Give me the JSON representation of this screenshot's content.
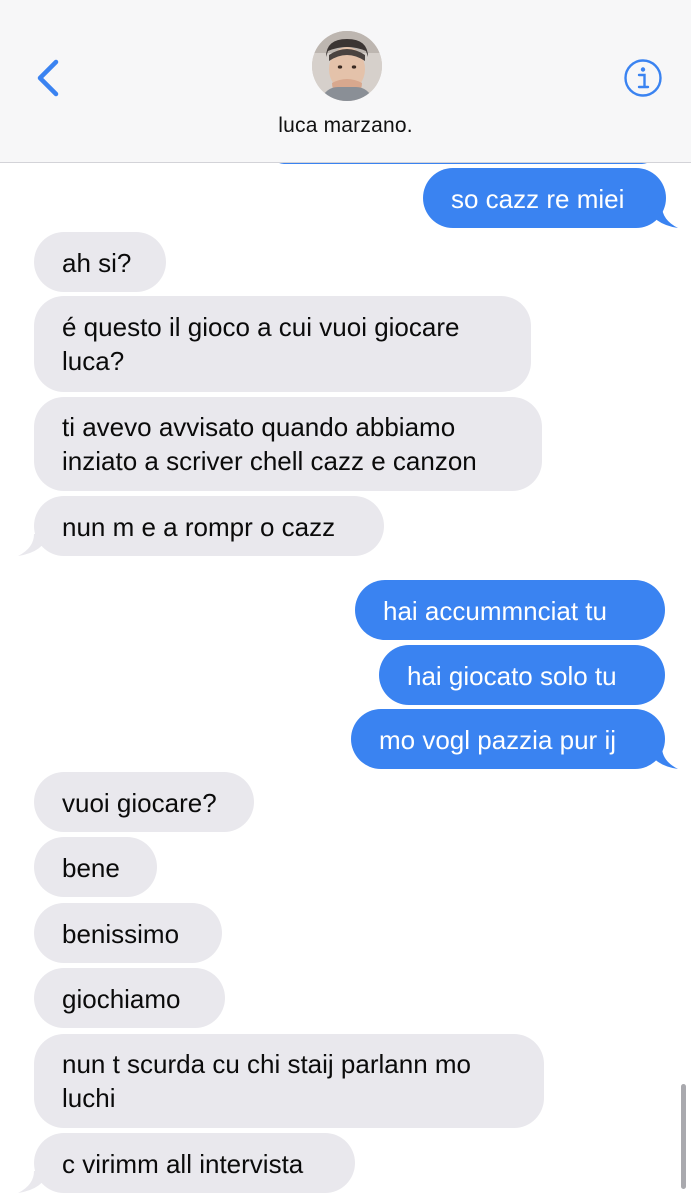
{
  "header": {
    "contact_name": "luca marzano.",
    "back_icon": "chevron-left-icon",
    "info_icon": "info-icon",
    "accent_color": "#3a83f1"
  },
  "messages": [
    {
      "direction": "outgoing",
      "text": "so cazz re miei"
    },
    {
      "direction": "incoming",
      "text": "ah si?"
    },
    {
      "direction": "incoming",
      "lines": [
        "é questo il gioco a cui vuoi giocare",
        "luca?"
      ]
    },
    {
      "direction": "incoming",
      "lines": [
        "ti avevo avvisato quando abbiamo",
        "inziato a scriver chell cazz e canzon"
      ]
    },
    {
      "direction": "incoming",
      "text": "nun m e a rompr o cazz"
    },
    {
      "direction": "outgoing",
      "text": "hai accummnciat tu"
    },
    {
      "direction": "outgoing",
      "text": "hai giocato solo tu"
    },
    {
      "direction": "outgoing",
      "text": "mo vogl pazzia pur ij"
    },
    {
      "direction": "incoming",
      "text": "vuoi giocare?"
    },
    {
      "direction": "incoming",
      "text": "bene"
    },
    {
      "direction": "incoming",
      "text": "benissimo"
    },
    {
      "direction": "incoming",
      "text": "giochiamo"
    },
    {
      "direction": "incoming",
      "lines": [
        "nun t scurda cu chi staij parlann mo",
        "luchi"
      ]
    },
    {
      "direction": "incoming",
      "text": "c virimm all intervista"
    }
  ],
  "colors": {
    "incoming_bubble": "#e9e8ed",
    "outgoing_bubble": "#3a83f1"
  }
}
